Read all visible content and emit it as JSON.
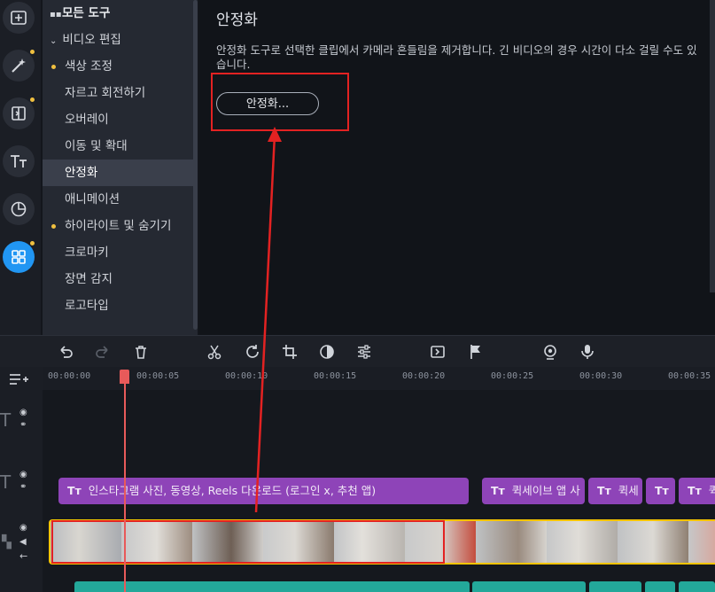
{
  "rail": {
    "icons": [
      "add-media-icon",
      "magic-wand-icon",
      "transition-icon",
      "text-icon",
      "sticker-icon",
      "all-tools-icon"
    ],
    "active_index": 5,
    "accent_color": "#2196f3"
  },
  "toollist": {
    "header": "모든 도구",
    "section": "비디오 편집",
    "items": [
      {
        "label": "색상 조정",
        "dot": true
      },
      {
        "label": "자르고 회전하기",
        "dot": false
      },
      {
        "label": "오버레이",
        "dot": false
      },
      {
        "label": "이동 및 확대",
        "dot": false
      },
      {
        "label": "안정화",
        "dot": false,
        "selected": true
      },
      {
        "label": "애니메이션",
        "dot": false
      },
      {
        "label": "하이라이트 및 숨기기",
        "dot": true
      },
      {
        "label": "크로마키",
        "dot": false
      },
      {
        "label": "장면 감지",
        "dot": false
      },
      {
        "label": "로고타입",
        "dot": false
      }
    ]
  },
  "panel": {
    "title": "안정화",
    "description": "안정화 도구로 선택한 클립에서 카메라 흔들림을 제거합니다. 긴 비디오의 경우 시간이 다소 걸릴 수도 있습니다.",
    "button_label": "안정화..."
  },
  "toolbar": {
    "icons": [
      "undo-icon",
      "redo-icon",
      "delete-icon",
      "cut-icon",
      "rotate-icon",
      "crop-icon",
      "color-icon",
      "adjust-icon",
      "pip-icon",
      "flag-icon",
      "webcam-icon",
      "mic-icon"
    ]
  },
  "ruler": {
    "ticks": [
      "00:00:00",
      "00:00:05",
      "00:00:10",
      "00:00:15",
      "00:00:20",
      "00:00:25",
      "00:00:30",
      "00:00:35"
    ]
  },
  "timeline": {
    "title_clips": [
      {
        "label": "인스타그램 사진, 동영상, Reels 다운로드 (로그인 x, 추천 앱)"
      },
      {
        "label": "퀵세이브 앱 사"
      },
      {
        "label": "퀵세"
      },
      {
        "label": ""
      },
      {
        "label": "퀵"
      }
    ],
    "selection_color": "#f5c400",
    "annotation_color": "#e32222"
  }
}
